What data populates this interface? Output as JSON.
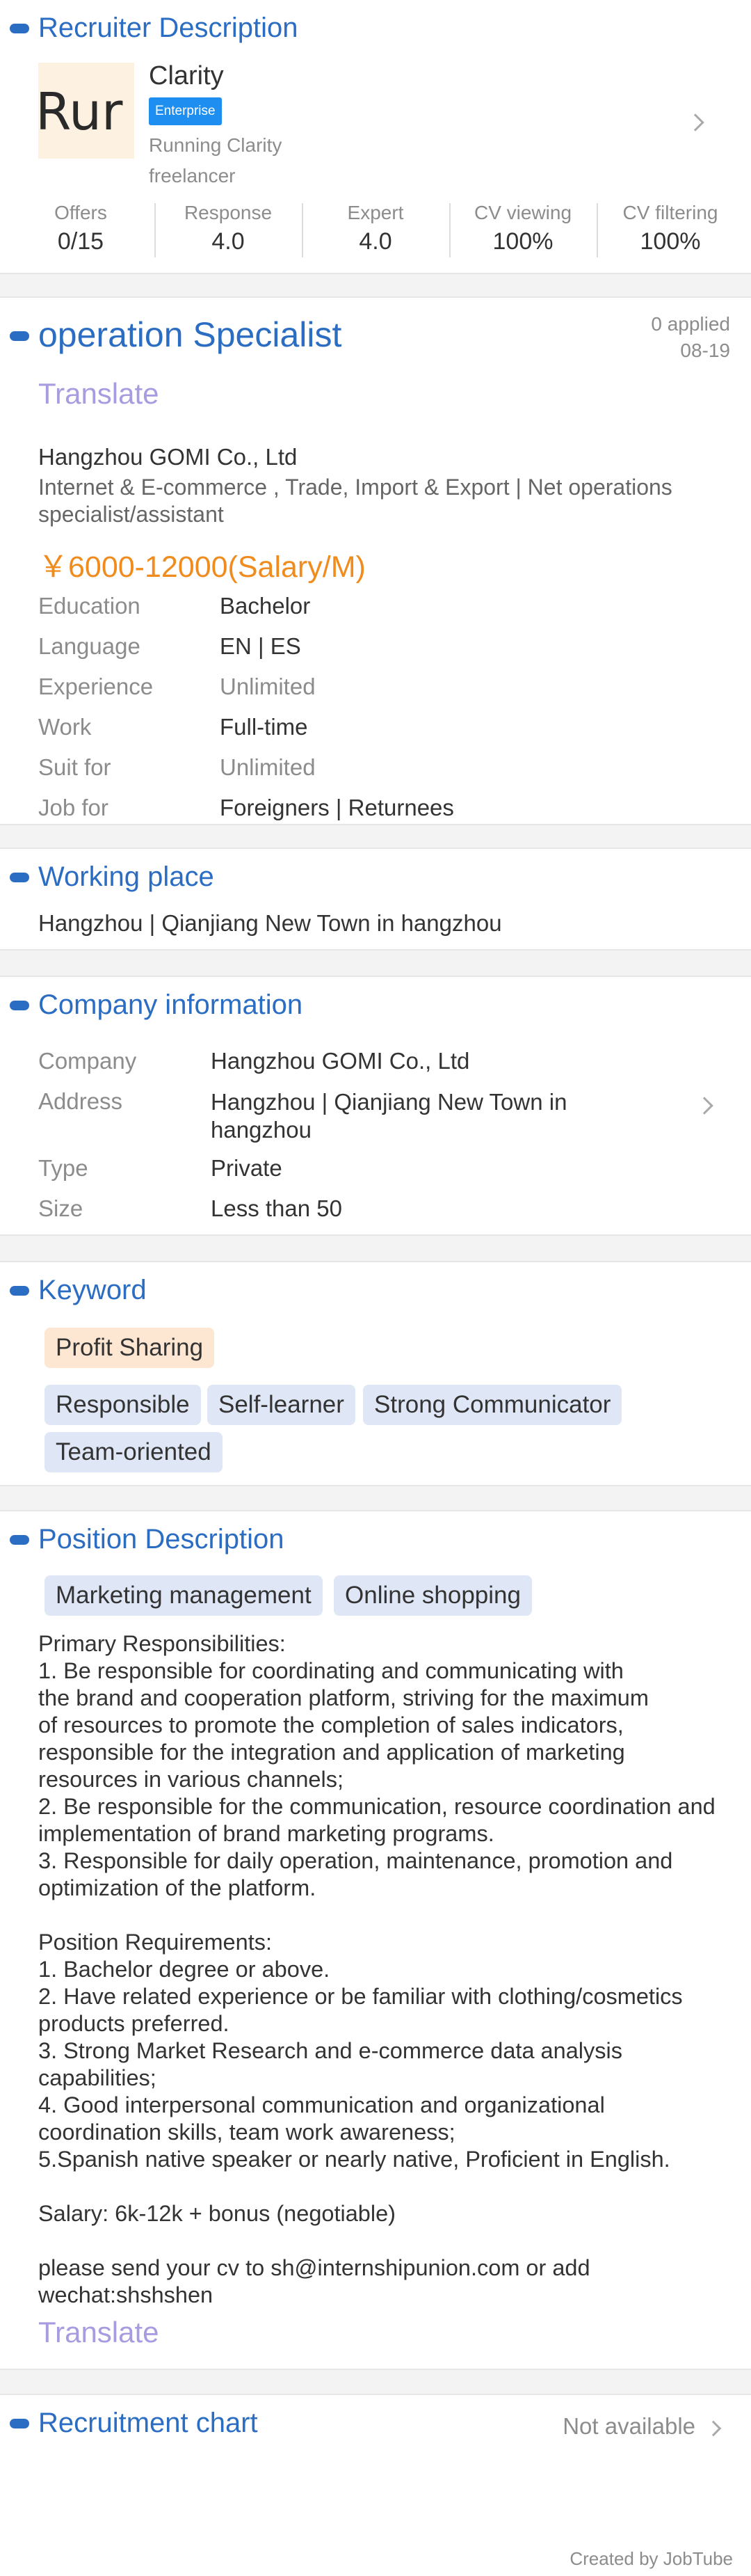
{
  "recruiter": {
    "section_title": "Recruiter Description",
    "logo_text": "Rur",
    "name": "Clarity",
    "badge": "Enterprise",
    "line1": "Running Clarity",
    "line2": "freelancer",
    "stats": [
      {
        "label": "Offers",
        "value": "0/15"
      },
      {
        "label": "Response",
        "value": "4.0"
      },
      {
        "label": "Expert",
        "value": "4.0"
      },
      {
        "label": "CV viewing",
        "value": "100%"
      },
      {
        "label": "CV filtering",
        "value": "100%"
      }
    ]
  },
  "job": {
    "title": "operation Specialist",
    "applied": "0 applied",
    "date": "08-19",
    "translate": "Translate",
    "company": "Hangzhou GOMI Co., Ltd",
    "industry": "Internet & E-commerce , Trade, Import & Export  | Net operations specialist/assistant",
    "salary": "￥6000-12000(Salary/M)",
    "details": [
      {
        "label": "Education",
        "value": "Bachelor"
      },
      {
        "label": "Language",
        "value": "EN | ES"
      },
      {
        "label": "Experience",
        "value": "Unlimited"
      },
      {
        "label": "Work",
        "value": "Full-time"
      },
      {
        "label": "Suit for",
        "value": "Unlimited"
      },
      {
        "label": "Job for",
        "value": "Foreigners | Returnees"
      }
    ]
  },
  "working_place": {
    "section_title": "Working place",
    "value": "Hangzhou  | Qianjiang New Town in hangzhou"
  },
  "company": {
    "section_title": "Company information",
    "rows": [
      {
        "label": "Company",
        "value": "Hangzhou GOMI Co., Ltd"
      },
      {
        "label": "Address",
        "value": "Hangzhou | Qianjiang New Town in hangzhou"
      },
      {
        "label": "Type",
        "value": "Private"
      },
      {
        "label": "Size",
        "value": "Less than 50"
      }
    ]
  },
  "keyword": {
    "section_title": "Keyword",
    "benefit_tags": [
      "Profit Sharing"
    ],
    "trait_tags": [
      "Responsible",
      "Self-learner",
      "Strong Communicator",
      "Team-oriented"
    ]
  },
  "position": {
    "section_title": "Position Description",
    "tags": [
      "Marketing management",
      "Online shopping"
    ],
    "description": "Primary Responsibilities:\n1. Be responsible for coordinating and communicating with\nthe brand and cooperation platform, striving for the maximum\nof resources to promote the completion of sales indicators,\nresponsible for the integration and application of marketing\nresources in various channels;\n2. Be responsible for the communication, resource coordination and\nimplementation of brand marketing programs.\n3. Responsible for daily operation, maintenance, promotion and\noptimization of the platform.\n\nPosition Requirements:\n1. Bachelor degree or above.\n2. Have related experience or be familiar with clothing/cosmetics\nproducts preferred.\n3. Strong Market Research and e-commerce data analysis\ncapabilities;\n4. Good interpersonal communication and organizational\ncoordination skills, team work awareness;\n5.Spanish native speaker or nearly native, Proficient in English.\n\nSalary: 6k-12k + bonus (negotiable)\n\nplease send your cv to sh@internshipunion.com or add\nwechat:shshshen",
    "translate": "Translate"
  },
  "recruitment_chart": {
    "section_title": "Recruitment chart",
    "status": "Not available"
  },
  "footer": {
    "credit": "Created by JobTube"
  },
  "colors": {
    "accent": "#2b6dc2",
    "salary": "#f08c1e",
    "translate": "#a89be0",
    "badge": "#1f8ef1"
  }
}
